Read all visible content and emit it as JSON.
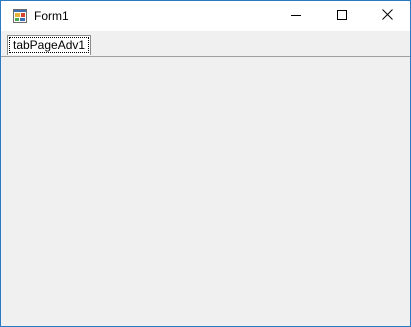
{
  "window": {
    "title": "Form1",
    "accent_color": "#2b79c2"
  },
  "titlebar": {
    "icon": "form-app-icon",
    "minimize_icon": "minimize-icon",
    "maximize_icon": "maximize-icon",
    "close_icon": "close-icon"
  },
  "tabs": [
    {
      "label": "tabPageAdv1",
      "selected": true
    }
  ]
}
